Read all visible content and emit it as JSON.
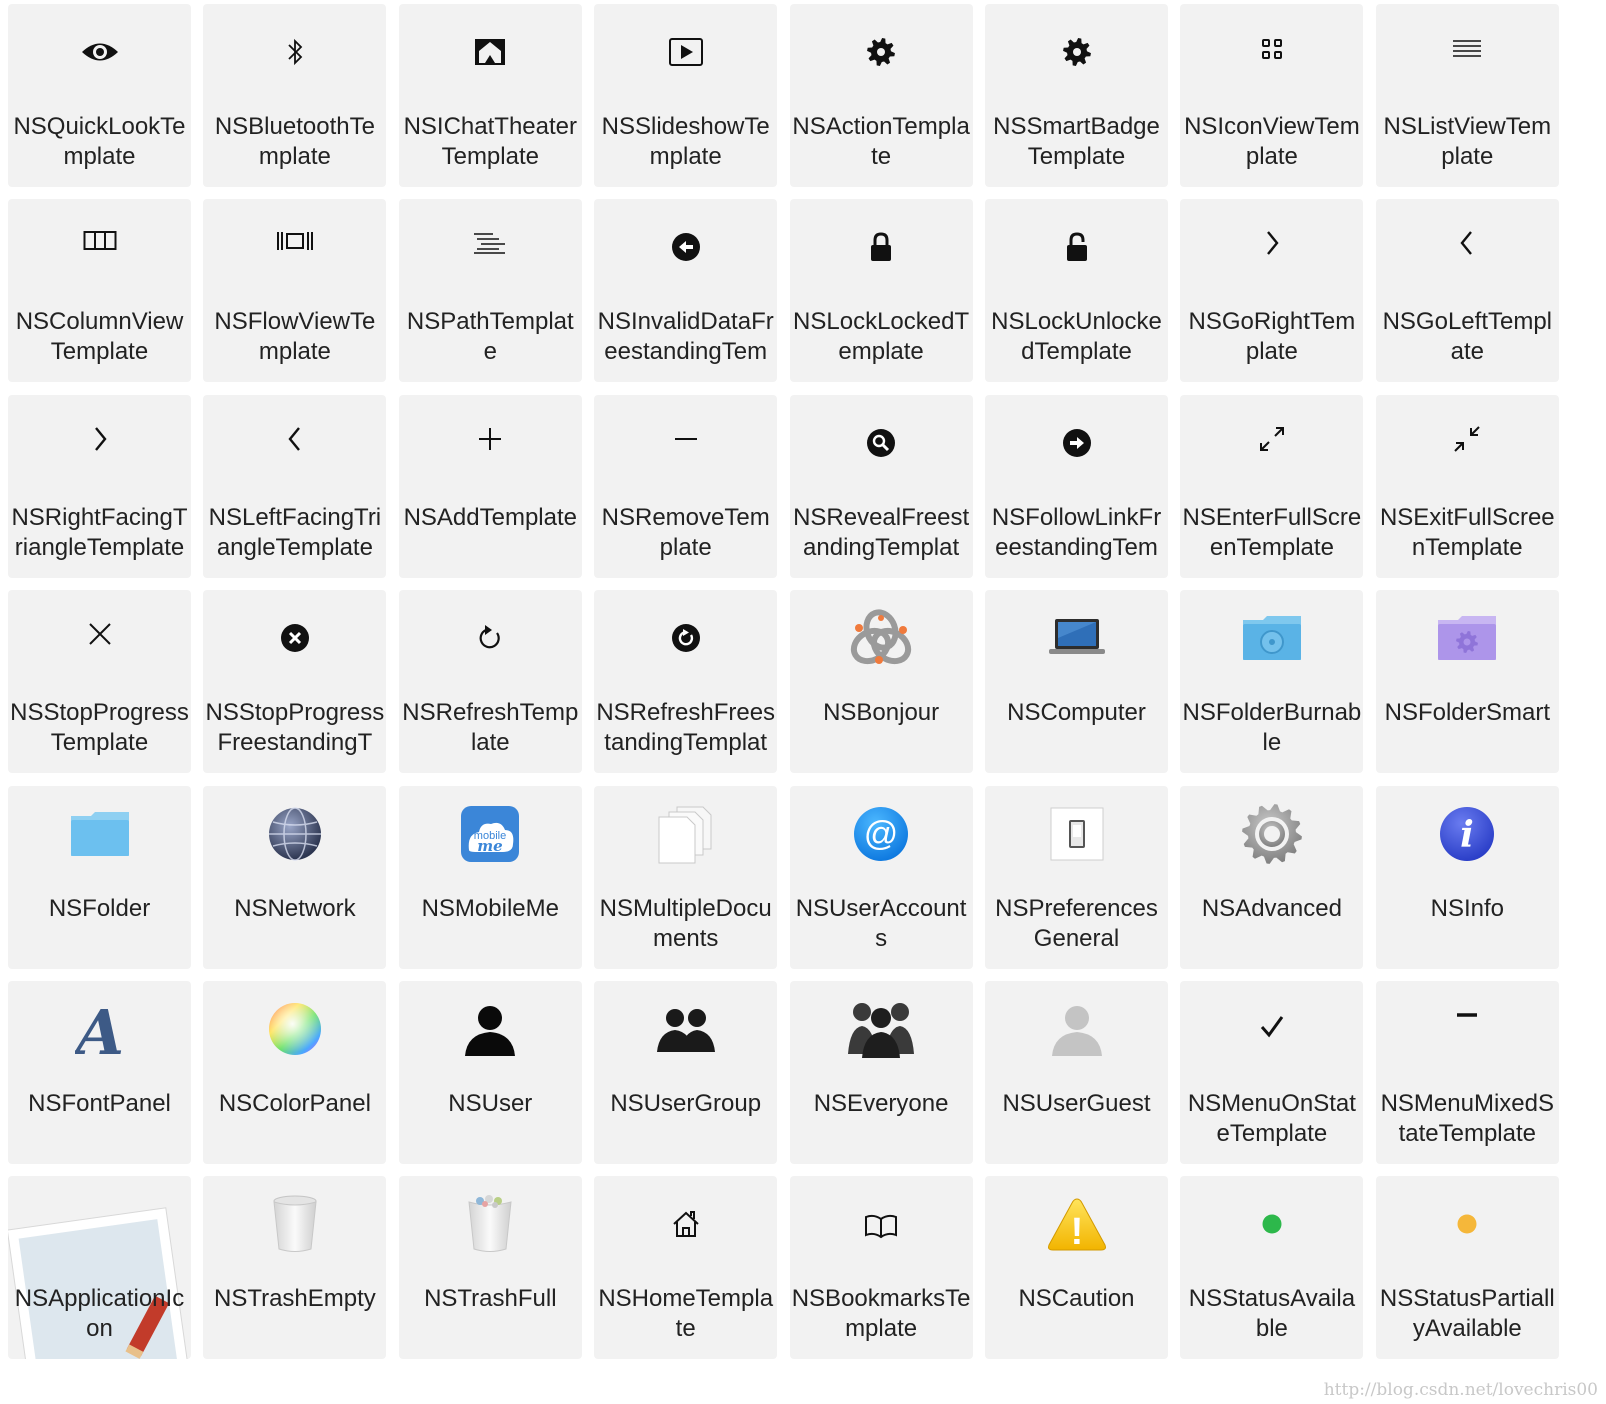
{
  "tiles": [
    {
      "label": "NSQuickLookTemplate",
      "icon": "eye-icon"
    },
    {
      "label": "NSBluetoothTemplate",
      "icon": "bluetooth-icon"
    },
    {
      "label": "NSIChatTheaterTemplate",
      "icon": "ichat-theater-icon"
    },
    {
      "label": "NSSlideshowTemplate",
      "icon": "slideshow-icon"
    },
    {
      "label": "NSActionTemplate",
      "icon": "gear-icon"
    },
    {
      "label": "NSSmartBadgeTemplate",
      "icon": "gear-icon"
    },
    {
      "label": "NSIconViewTemplate",
      "icon": "icon-view-icon"
    },
    {
      "label": "NSListViewTemplate",
      "icon": "list-view-icon"
    },
    {
      "label": "NSColumnViewTemplate",
      "icon": "column-view-icon"
    },
    {
      "label": "NSFlowViewTemplate",
      "icon": "flow-view-icon"
    },
    {
      "label": "NSPathTemplate",
      "icon": "path-icon"
    },
    {
      "label": "NSInvalidDataFreestandingTem",
      "icon": "back-circle-icon"
    },
    {
      "label": "NSLockLockedTemplate",
      "icon": "lock-locked-icon"
    },
    {
      "label": "NSLockUnlockedTemplate",
      "icon": "lock-unlocked-icon"
    },
    {
      "label": "NSGoRightTemplate",
      "icon": "chevron-right-icon"
    },
    {
      "label": "NSGoLeftTemplate",
      "icon": "chevron-left-icon"
    },
    {
      "label": "NSRightFacingTriangleTemplate",
      "icon": "chevron-right-icon"
    },
    {
      "label": "NSLeftFacingTriangleTemplate",
      "icon": "chevron-left-icon"
    },
    {
      "label": "NSAddTemplate",
      "icon": "plus-icon"
    },
    {
      "label": "NSRemoveTemplate",
      "icon": "minus-icon"
    },
    {
      "label": "NSRevealFreestandingTemplat",
      "icon": "reveal-search-icon"
    },
    {
      "label": "NSFollowLinkFreestandingTem",
      "icon": "follow-link-icon"
    },
    {
      "label": "NSEnterFullScreenTemplate",
      "icon": "enter-fullscreen-icon"
    },
    {
      "label": "NSExitFullScreenTemplate",
      "icon": "exit-fullscreen-icon"
    },
    {
      "label": "NSStopProgressTemplate",
      "icon": "close-icon"
    },
    {
      "label": "NSStopProgressFreestandingT",
      "icon": "close-circle-icon"
    },
    {
      "label": "NSRefreshTemplate",
      "icon": "refresh-icon"
    },
    {
      "label": "NSRefreshFreestandingTemplat",
      "icon": "refresh-circle-icon"
    },
    {
      "label": "NSBonjour",
      "icon": "bonjour-icon"
    },
    {
      "label": "NSComputer",
      "icon": "laptop-icon"
    },
    {
      "label": "NSFolderBurnable",
      "icon": "burnable-folder-icon"
    },
    {
      "label": "NSFolderSmart",
      "icon": "smart-folder-icon"
    },
    {
      "label": "NSFolder",
      "icon": "folder-icon"
    },
    {
      "label": "NSNetwork",
      "icon": "globe-icon"
    },
    {
      "label": "NSMobileMe",
      "icon": "mobileme-icon",
      "icon_text": "mobile",
      "icon_text2": "me"
    },
    {
      "label": "NSMultipleDocuments",
      "icon": "documents-icon"
    },
    {
      "label": "NSUserAccounts",
      "icon": "at-sign-icon",
      "icon_text": "@"
    },
    {
      "label": "NSPreferencesGeneral",
      "icon": "switch-icon"
    },
    {
      "label": "NSAdvanced",
      "icon": "gear-large-icon"
    },
    {
      "label": "NSInfo",
      "icon": "info-icon",
      "icon_text": "i"
    },
    {
      "label": "NSFontPanel",
      "icon": "font-icon",
      "icon_text": "A"
    },
    {
      "label": "NSColorPanel",
      "icon": "color-wheel-icon"
    },
    {
      "label": "NSUser",
      "icon": "user-icon"
    },
    {
      "label": "NSUserGroup",
      "icon": "user-group-icon"
    },
    {
      "label": "NSEveryone",
      "icon": "everyone-icon"
    },
    {
      "label": "NSUserGuest",
      "icon": "user-guest-icon"
    },
    {
      "label": "NSMenuOnStateTemplate",
      "icon": "checkmark-icon"
    },
    {
      "label": "NSMenuMixedStateTemplate",
      "icon": "dash-icon"
    },
    {
      "label": "NSApplicationIcon",
      "icon": "application-icon"
    },
    {
      "label": "NSTrashEmpty",
      "icon": "trash-empty-icon"
    },
    {
      "label": "NSTrashFull",
      "icon": "trash-full-icon"
    },
    {
      "label": "NSHomeTemplate",
      "icon": "home-icon"
    },
    {
      "label": "NSBookmarksTemplate",
      "icon": "book-icon"
    },
    {
      "label": "NSCaution",
      "icon": "caution-icon",
      "icon_text": "!"
    },
    {
      "label": "NSStatusAvailable",
      "icon": "status-dot-icon",
      "color": "#2db84b"
    },
    {
      "label": "NSStatusPartiallyAvailable",
      "icon": "status-dot-icon",
      "color": "#f5b73a"
    }
  ],
  "watermark": "http://blog.csdn.net/lovechris00"
}
